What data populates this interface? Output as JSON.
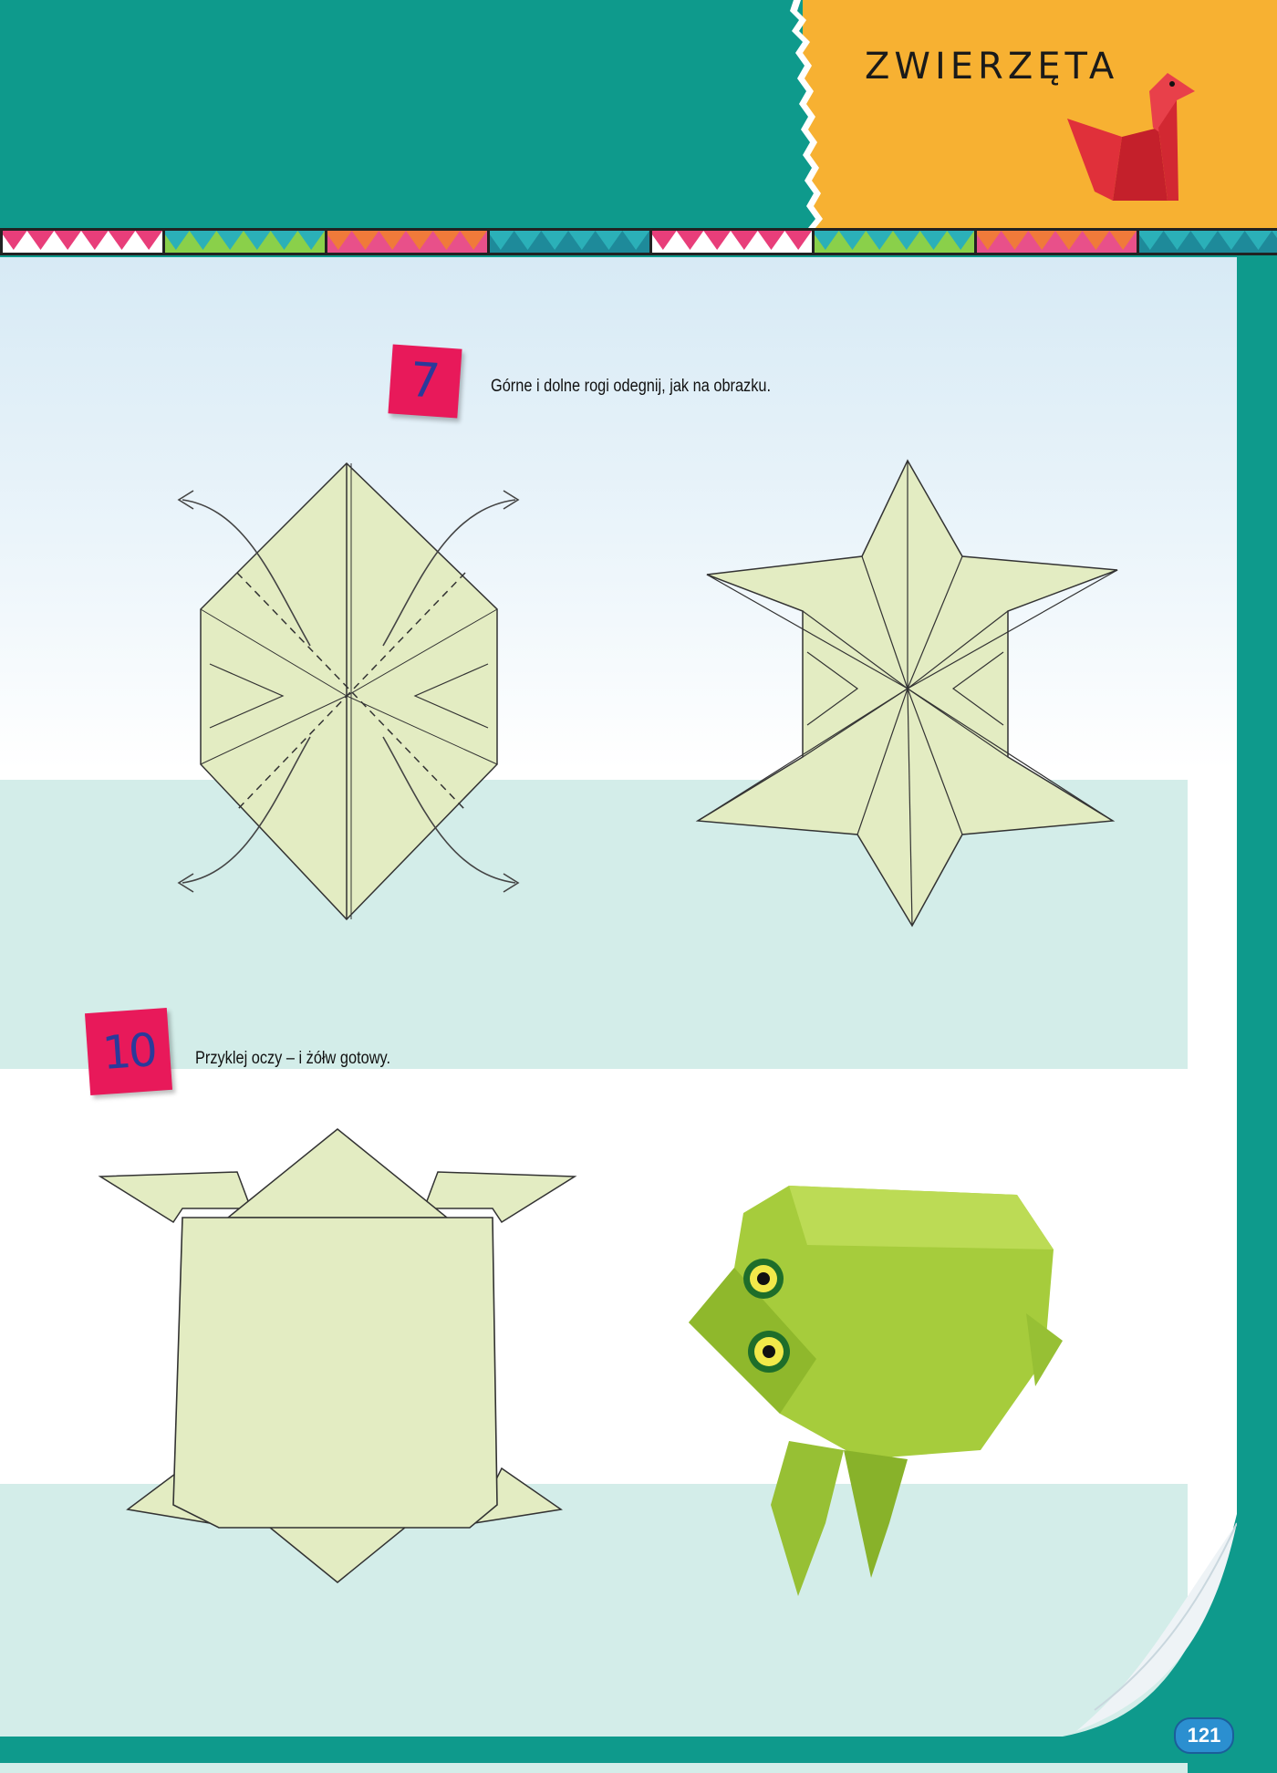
{
  "header": {
    "section_title": "ZWIERZĘTA",
    "teal_color": "#0e9a8c",
    "orange_color": "#f7b132",
    "illustration_icon": "origami-bird-icon"
  },
  "steps": [
    {
      "number": "7",
      "text": "Górne i dolne rogi odegnij, jak na obrazku."
    },
    {
      "number": "10",
      "text": "Przyklej oczy – i żółw gotowy."
    }
  ],
  "images": {
    "step7_left": "fold-diagram-before-icon",
    "step7_right": "fold-diagram-after-icon",
    "step10_left": "turtle-diagram-icon",
    "step10_right": "origami-frog-photo-icon"
  },
  "colors": {
    "paper": "#e3ecc2",
    "badge": "#e8195a",
    "band": "#d3ede9",
    "frog": "#a6cc3c"
  },
  "footer": {
    "page_number": "121"
  }
}
